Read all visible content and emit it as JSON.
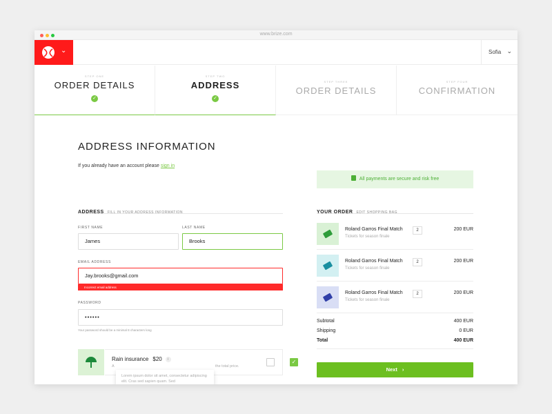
{
  "browser": {
    "url": "www.brize.com",
    "dot_colors": [
      "#ff5f57",
      "#ffbd2e",
      "#28c840"
    ]
  },
  "header": {
    "logo_color": "#ff1a1a",
    "user_name": "Sofia"
  },
  "steps": [
    {
      "label": "STEP ONE",
      "title": "ORDER DETAILS",
      "completed": true
    },
    {
      "label": "STEP TWO",
      "title": "ADDRESS",
      "completed": true,
      "active": true
    },
    {
      "label": "STEP THREE",
      "title": "ORDER DETAILS",
      "completed": false
    },
    {
      "label": "STEP FOUR",
      "title": "CONFIRMATION",
      "completed": false
    }
  ],
  "main": {
    "title": "ADDRESS INFORMATION",
    "account_prompt": "If you already have an account please ",
    "signin_link": "sign in",
    "secure_notice": "All payments are secure and risk free"
  },
  "address_form": {
    "section_title": "ADDRESS",
    "section_sub": "FILL IN YOUR ADDRESS INFORMATION",
    "first_name_label": "FIRST NAME",
    "first_name": "James",
    "last_name_label": "LAST NAME",
    "last_name": "Brooks",
    "email_label": "EMAIL ADDRESS",
    "email": "Jay.brooks@gmail.com",
    "email_error": "Incorrect email address",
    "password_label": "PASSWORD",
    "password": "••••••",
    "password_hint": "Your password should be a minimal 8 characters long"
  },
  "insurance": {
    "name": "Rain insurance",
    "price": "$20",
    "info": "i",
    "desc_left": "A",
    "desc_right": "the total price.",
    "tooltip": "Lorem ipsum dolor sit amet, consectetur adipiscing elit. Cras sed sapien quam. Sed",
    "checked": true
  },
  "order": {
    "section_title": "YOUR ORDER",
    "edit_link": "EDIT SHOPPING BAG",
    "items": [
      {
        "name": "Roland Garros Final Match",
        "sub": "Tickets for season finale",
        "qty": "2",
        "price": "200 EUR",
        "thumb_bg": "#d9f1d5",
        "ticket_color": "#2e9c3a"
      },
      {
        "name": "Roland Garros Final Match",
        "sub": "Tickets for season finale",
        "qty": "2",
        "price": "200 EUR",
        "thumb_bg": "#d3f0f2",
        "ticket_color": "#1a8fa0"
      },
      {
        "name": "Roland Garros Final Match",
        "sub": "Tickets for season finale",
        "qty": "2",
        "price": "200 EUR",
        "thumb_bg": "#d9def5",
        "ticket_color": "#3140a8"
      }
    ],
    "subtotal_label": "Subtotal",
    "subtotal": "400 EUR",
    "shipping_label": "Shipping",
    "shipping": "0 EUR",
    "total_label": "Total",
    "total": "400 EUR",
    "next_label": "Next",
    "next_icon": "›"
  }
}
